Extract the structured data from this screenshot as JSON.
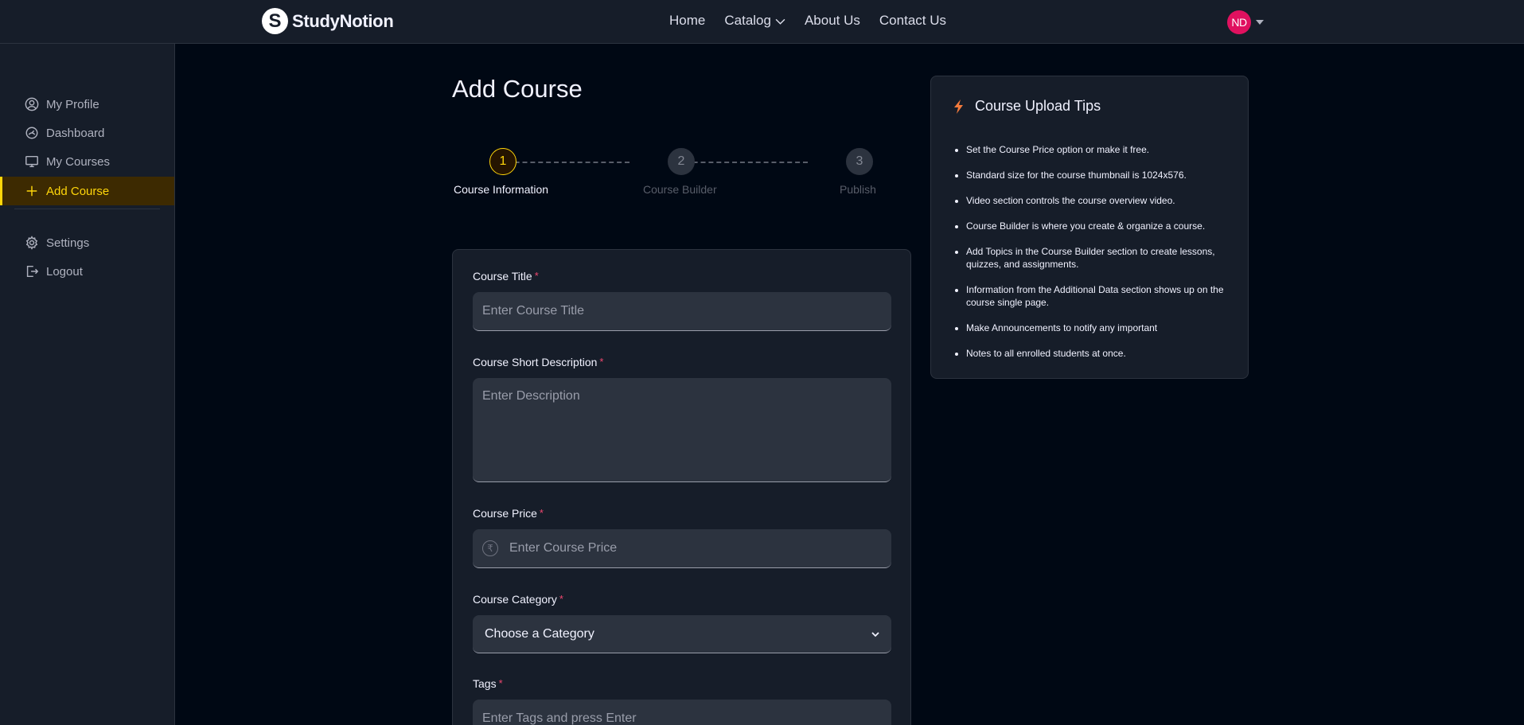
{
  "nav": {
    "logo_mark": "S",
    "logo_text": "StudyNotion",
    "links": [
      "Home",
      "Catalog",
      "About Us",
      "Contact Us"
    ],
    "avatar_initials": "ND"
  },
  "sidebar": {
    "items": [
      {
        "label": "My Profile",
        "icon": "user-circle-icon"
      },
      {
        "label": "Dashboard",
        "icon": "gauge-icon"
      },
      {
        "label": "My Courses",
        "icon": "monitor-icon"
      },
      {
        "label": "Add Course",
        "icon": "plus-icon",
        "active": true
      }
    ],
    "bottom_items": [
      {
        "label": "Settings",
        "icon": "gear-icon"
      },
      {
        "label": "Logout",
        "icon": "logout-icon"
      }
    ]
  },
  "page": {
    "title": "Add Course"
  },
  "stepper": {
    "current": 1,
    "steps": [
      {
        "number": "1",
        "label": "Course Information"
      },
      {
        "number": "2",
        "label": "Course Builder"
      },
      {
        "number": "3",
        "label": "Publish"
      }
    ]
  },
  "form": {
    "title_label": "Course Title",
    "title_placeholder": "Enter Course Title",
    "desc_label": "Course Short Description",
    "desc_placeholder": "Enter Description",
    "price_label": "Course Price",
    "price_placeholder": "Enter Course Price",
    "price_icon": "₹",
    "category_label": "Course Category",
    "category_value": "Choose a Category",
    "tags_label": "Tags",
    "tags_placeholder": "Enter Tags and press Enter",
    "required_mark": "*"
  },
  "tips": {
    "title": "Course Upload Tips",
    "items": [
      "Set the Course Price option or make it free.",
      "Standard size for the course thumbnail is 1024x576.",
      "Video section controls the course overview video.",
      "Course Builder is where you create & organize a course.",
      "Add Topics in the Course Builder section to create lessons, quizzes, and assignments.",
      "Information from the Additional Data section shows up on the course single page.",
      "Make Announcements to notify any important",
      "Notes to all enrolled students at once."
    ]
  },
  "colors": {
    "background": "#000814",
    "panel": "#161D29",
    "accent": "#FFD60A",
    "required": "#EF476F",
    "avatar": "#E0115F"
  }
}
